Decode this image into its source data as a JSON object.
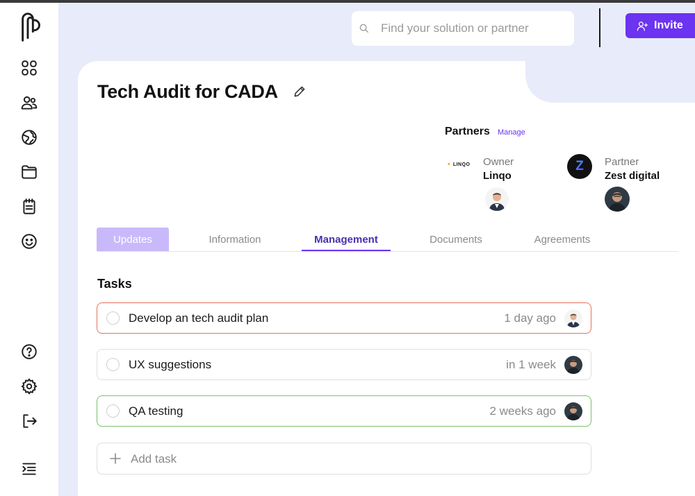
{
  "search": {
    "placeholder": "Find your solution or partner"
  },
  "header": {
    "invite_label": "Invite"
  },
  "page": {
    "title": "Tech Audit for CADA"
  },
  "partners": {
    "title": "Partners",
    "manage_label": "Manage",
    "owner": {
      "role": "Owner",
      "name": "Linqo",
      "logo_text": "LINQO"
    },
    "partner": {
      "role": "Partner",
      "name": "Zest digital",
      "logo_text": "Z"
    }
  },
  "tabs": [
    {
      "label": "Updates"
    },
    {
      "label": "Information"
    },
    {
      "label": "Management"
    },
    {
      "label": "Documents"
    },
    {
      "label": "Agreements"
    }
  ],
  "active_tab": "Management",
  "tasks": {
    "title": "Tasks",
    "items": [
      {
        "label": "Develop an tech audit plan",
        "time": "1 day ago",
        "status_color": "#e8705c"
      },
      {
        "label": "UX suggestions",
        "time": "in 1 week",
        "status_color": "#dedede"
      },
      {
        "label": "QA testing",
        "time": "2 weeks ago",
        "status_color": "#7cc06a"
      }
    ],
    "add_label": "Add task"
  },
  "colors": {
    "accent": "#6c33f0",
    "background": "#e8ebfa"
  }
}
